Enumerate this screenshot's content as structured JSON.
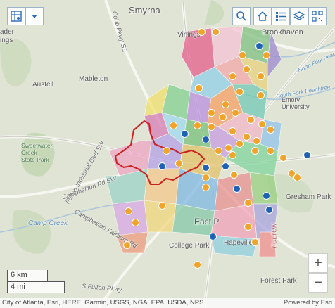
{
  "places": [
    {
      "key": "smyrna",
      "label": "Smyrna"
    },
    {
      "key": "brookhaven",
      "label": "Brookhaven"
    },
    {
      "key": "vinings",
      "label": "Vinings"
    },
    {
      "key": "austell",
      "label": "Austell"
    },
    {
      "key": "mableton",
      "label": "Mableton"
    },
    {
      "key": "emory",
      "label": "Emory University"
    },
    {
      "key": "sweetwater",
      "label": "Sweetwater Creek State Park"
    },
    {
      "key": "gresham",
      "label": "Gresham Park"
    },
    {
      "key": "eastpoint",
      "label": "East P"
    },
    {
      "key": "collegepark",
      "label": "College Park"
    },
    {
      "key": "hapeville",
      "label": "Hapeville"
    },
    {
      "key": "forestpark",
      "label": "Forest Park"
    },
    {
      "key": "ader",
      "label": "ader"
    },
    {
      "key": "ings",
      "label": "ings"
    }
  ],
  "water_labels": [
    {
      "key": "northfork",
      "label": "North Fork Peachtree"
    },
    {
      "key": "southfork",
      "label": "South Fork Peachtree"
    },
    {
      "key": "campcreek",
      "label": "Camp Creek"
    }
  ],
  "road_labels": [
    {
      "key": "cobbpkwy",
      "label": "Cobb Pkwy SE"
    },
    {
      "key": "camphill",
      "label": "Campbellton Rd SW"
    },
    {
      "key": "campfairburn",
      "label": "Campbellton Fairburn Rd"
    },
    {
      "key": "fultonind",
      "label": "Fulton Industrial Blvd SW"
    },
    {
      "key": "sfulton",
      "label": "S Fulton Pkwy"
    },
    {
      "key": "fulton",
      "label": "FULTON"
    }
  ],
  "toolbar_left": [
    {
      "name": "basemap-gallery-button",
      "icon": "map-grid-icon"
    },
    {
      "name": "dropdown-button",
      "icon": "caret-down-icon"
    }
  ],
  "toolbar_right": [
    {
      "name": "search-button",
      "icon": "search-icon"
    },
    {
      "name": "home-button",
      "icon": "home-icon"
    },
    {
      "name": "legend-button",
      "icon": "legend-list-icon"
    },
    {
      "name": "layers-button",
      "icon": "layers-icon"
    },
    {
      "name": "qr-code-button",
      "icon": "qr-code-icon"
    }
  ],
  "scale": {
    "km": "6 km",
    "mi": "4 mi"
  },
  "zoom": {
    "in": "+",
    "out": "−"
  },
  "attribution": {
    "left": "City of Atlanta, Esri, HERE, Garmin, USGS, NGA, EPA, USDA, NPS",
    "right": "Powered by Esri"
  },
  "colors": {
    "accent": "#2b6cb8",
    "boundary": "#cc1f1f",
    "marker_orange": "#f0a52a",
    "marker_blue": "#1f62b5"
  }
}
